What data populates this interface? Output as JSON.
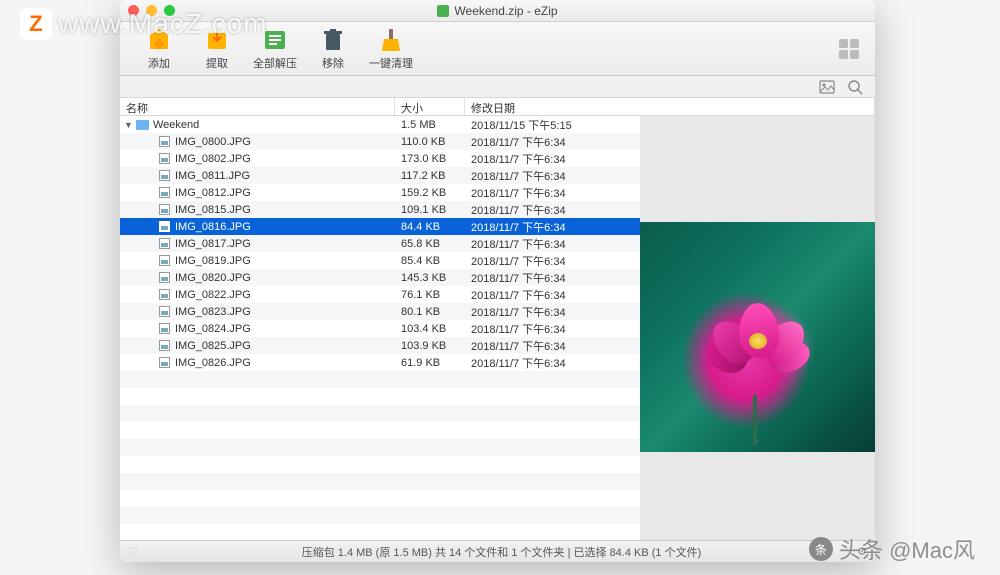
{
  "watermark": {
    "logo": "Z",
    "url": "www.MacZ.com",
    "bottom": "头条 @Mac风"
  },
  "window": {
    "title": "Weekend.zip - eZip",
    "toolbar": {
      "add": "添加",
      "extract": "提取",
      "extract_all": "全部解压",
      "remove": "移除",
      "clean": "一键清理"
    },
    "columns": {
      "name": "名称",
      "size": "大小",
      "date": "修改日期"
    },
    "folder": {
      "name": "Weekend",
      "size": "1.5 MB",
      "date": "2018/11/15 下午5:15"
    },
    "files": [
      {
        "name": "IMG_0800.JPG",
        "size": "110.0 KB",
        "date": "2018/11/7 下午6:34"
      },
      {
        "name": "IMG_0802.JPG",
        "size": "173.0 KB",
        "date": "2018/11/7 下午6:34"
      },
      {
        "name": "IMG_0811.JPG",
        "size": "117.2 KB",
        "date": "2018/11/7 下午6:34"
      },
      {
        "name": "IMG_0812.JPG",
        "size": "159.2 KB",
        "date": "2018/11/7 下午6:34"
      },
      {
        "name": "IMG_0815.JPG",
        "size": "109.1 KB",
        "date": "2018/11/7 下午6:34"
      },
      {
        "name": "IMG_0816.JPG",
        "size": "84.4 KB",
        "date": "2018/11/7 下午6:34",
        "selected": true
      },
      {
        "name": "IMG_0817.JPG",
        "size": "65.8 KB",
        "date": "2018/11/7 下午6:34"
      },
      {
        "name": "IMG_0819.JPG",
        "size": "85.4 KB",
        "date": "2018/11/7 下午6:34"
      },
      {
        "name": "IMG_0820.JPG",
        "size": "145.3 KB",
        "date": "2018/11/7 下午6:34"
      },
      {
        "name": "IMG_0822.JPG",
        "size": "76.1 KB",
        "date": "2018/11/7 下午6:34"
      },
      {
        "name": "IMG_0823.JPG",
        "size": "80.1 KB",
        "date": "2018/11/7 下午6:34"
      },
      {
        "name": "IMG_0824.JPG",
        "size": "103.4 KB",
        "date": "2018/11/7 下午6:34"
      },
      {
        "name": "IMG_0825.JPG",
        "size": "103.9 KB",
        "date": "2018/11/7 下午6:34"
      },
      {
        "name": "IMG_0826.JPG",
        "size": "61.9 KB",
        "date": "2018/11/7 下午6:34"
      }
    ],
    "status": "压缩包 1.4 MB (原 1.5 MB) 共 14 个文件和 1 个文件夹   |   已选择 84.4 KB (1 个文件)"
  }
}
